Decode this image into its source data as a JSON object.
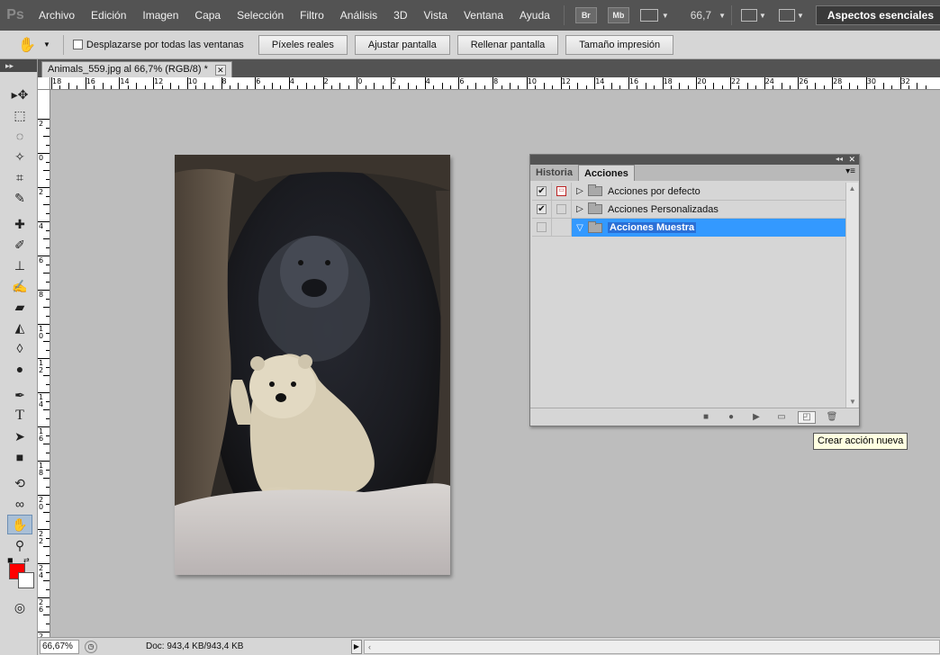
{
  "menubar": {
    "logo": "Ps",
    "items": [
      "Archivo",
      "Edición",
      "Imagen",
      "Capa",
      "Selección",
      "Filtro",
      "Análisis",
      "3D",
      "Vista",
      "Ventana",
      "Ayuda"
    ],
    "bridge_label": "Br",
    "minibridge_label": "Mb",
    "zoom_value": "66,7",
    "workspace_label": "Aspectos esenciales"
  },
  "options": {
    "scroll_all_label": "Desplazarse por todas las ventanas",
    "scroll_all_checked": false,
    "buttons": [
      "Píxeles reales",
      "Ajustar pantalla",
      "Rellenar pantalla",
      "Tamaño impresión"
    ]
  },
  "document": {
    "tab_title": "Animals_559.jpg al 66,7% (RGB/8) *",
    "close_glyph": "✕"
  },
  "rulers": {
    "horizontal": [
      "18",
      "16",
      "14",
      "12",
      "10",
      "8",
      "6",
      "4",
      "2",
      "0",
      "2",
      "4",
      "6",
      "8",
      "10",
      "12",
      "14",
      "16",
      "18",
      "20",
      "22",
      "24",
      "26",
      "28",
      "30",
      "32"
    ],
    "vertical": [
      "2",
      "0",
      "2",
      "4",
      "6",
      "8",
      "1 0",
      "1 2",
      "1 4",
      "1 6",
      "1 8",
      "2 0",
      "2 2",
      "2 4",
      "2 6",
      "2 8"
    ]
  },
  "statusbar": {
    "zoom": "66,67%",
    "doc_info": "Doc: 943,4 KB/943,4 KB"
  },
  "actions_panel": {
    "tabs": [
      "Historia",
      "Acciones"
    ],
    "active_tab": "Acciones",
    "rows": [
      {
        "label": "Acciones por defecto",
        "checked": true,
        "dialog": true,
        "expanded": false,
        "selected": false
      },
      {
        "label": "Acciones Personalizadas",
        "checked": true,
        "dialog": false,
        "expanded": false,
        "selected": false
      },
      {
        "label": "Acciones Muestra",
        "checked": false,
        "dialog": false,
        "expanded": true,
        "selected": true
      }
    ],
    "footer_buttons": [
      "stop-icon",
      "record-icon",
      "play-icon",
      "new-set-icon",
      "new-action-icon",
      "trash-icon"
    ]
  },
  "tooltip": {
    "text": "Crear acción nueva"
  },
  "colors": {
    "foreground": "#ff0000",
    "background": "#ffffff",
    "selection": "#3399ff"
  }
}
